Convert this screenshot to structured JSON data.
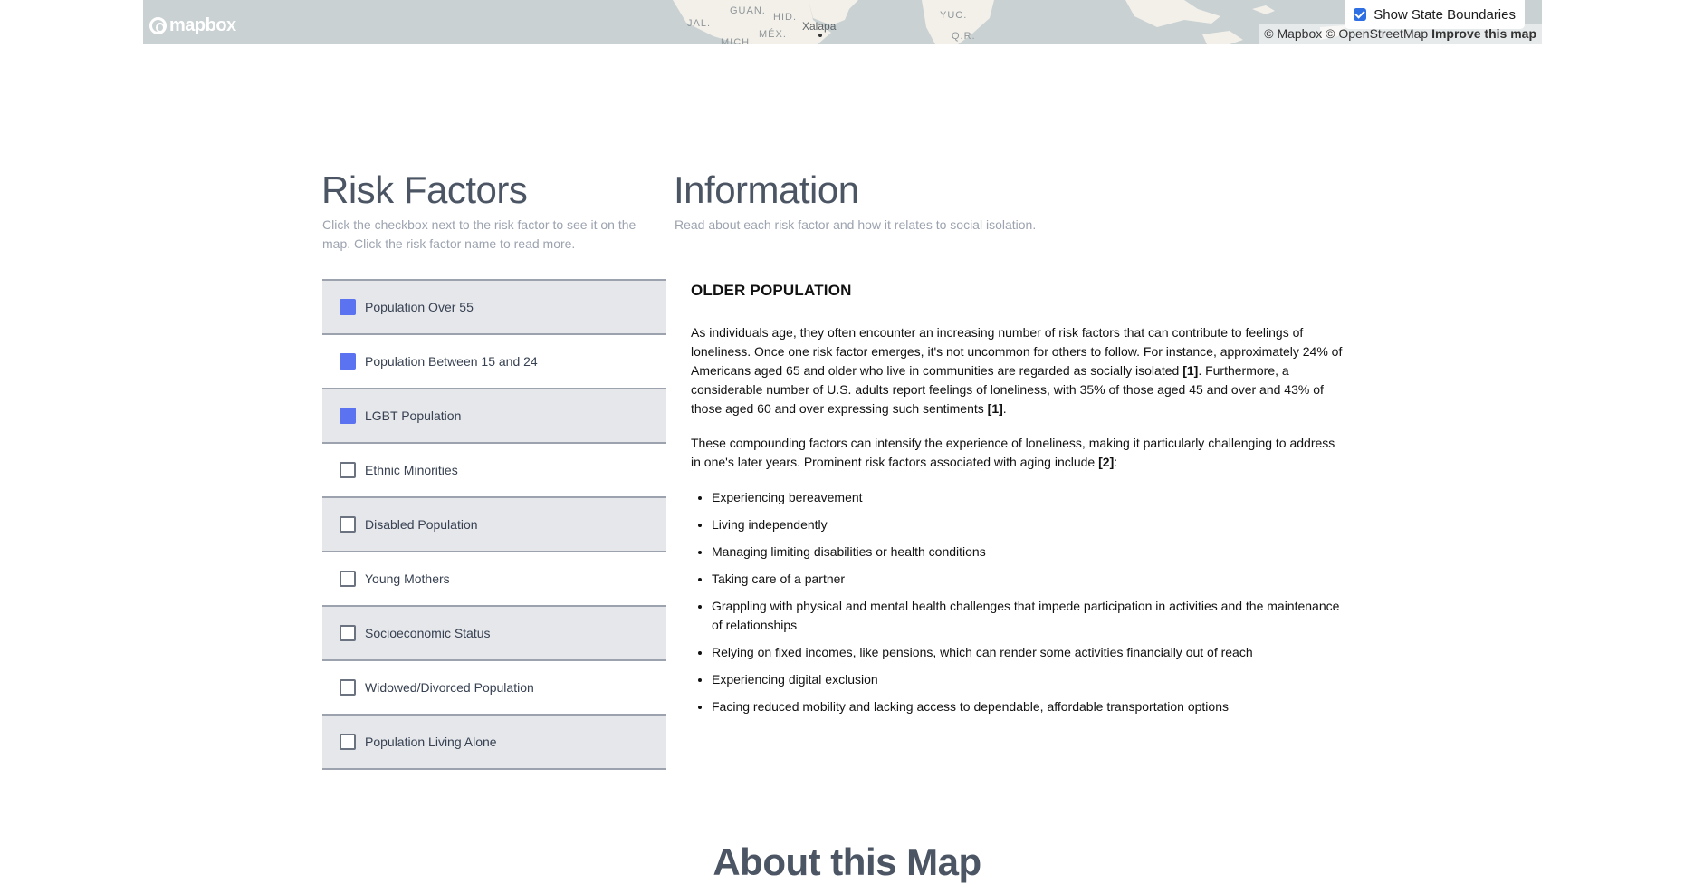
{
  "map": {
    "logo_text": "mapbox",
    "labels": {
      "guan": "GUAN.",
      "hid": "HID.",
      "jal": "JAL.",
      "mex": "MÉX.",
      "mich": "MICH.",
      "xalapa": "Xalapa",
      "yuc": "YUC.",
      "qr": "Q.R."
    },
    "attribution_mapbox": "© Mapbox",
    "attribution_osm": "© OpenStreetMap",
    "attribution_improve": "Improve this map",
    "boundaries_label": "Show State Boundaries",
    "boundaries_checked": true,
    "land_color": "#f3f0ea",
    "water_color": "#c9d1d3"
  },
  "risk": {
    "title": "Risk Factors",
    "subtitle": "Click the checkbox next to the risk factor to see it on the map. Click the risk factor name to read more.",
    "items": [
      {
        "label": "Population Over 55",
        "checked": true
      },
      {
        "label": "Population Between 15 and 24",
        "checked": true
      },
      {
        "label": "LGBT Population",
        "checked": true
      },
      {
        "label": "Ethnic Minorities",
        "checked": false
      },
      {
        "label": "Disabled Population",
        "checked": false
      },
      {
        "label": "Young Mothers",
        "checked": false
      },
      {
        "label": "Socioeconomic Status",
        "checked": false
      },
      {
        "label": "Widowed/Divorced Population",
        "checked": false
      },
      {
        "label": "Population Living Alone",
        "checked": false
      }
    ],
    "check_color": "#5b73f0"
  },
  "info": {
    "title": "Information",
    "subtitle": "Read about each risk factor and how it relates to social isolation.",
    "heading": "OLDER POPULATION",
    "p1_a": "As individuals age, they often encounter an increasing number of risk factors that can contribute to feelings of loneliness. Once one risk factor emerges, it's not uncommon for others to follow. For instance, approximately 24% of Americans aged 65 and older who live in communities are regarded as socially isolated ",
    "p1_ref1": "[1]",
    "p1_b": ". Furthermore, a considerable number of U.S. adults report feelings of loneliness, with 35% of those aged 45 and over and 43% of those aged 60 and over expressing such sentiments ",
    "p1_ref2": "[1]",
    "p1_c": ".",
    "p2_a": "These compounding factors can intensify the experience of loneliness, making it particularly challenging to address in one's later years. Prominent risk factors associated with aging include ",
    "p2_ref": "[2]",
    "p2_b": ":",
    "bullets": [
      "Experiencing bereavement",
      "Living independently",
      "Managing limiting disabilities or health conditions",
      "Taking care of a partner",
      "Grappling with physical and mental health challenges that impede participation in activities and the maintenance of relationships",
      "Relying on fixed incomes, like pensions, which can render some activities financially out of reach",
      "Experiencing digital exclusion",
      "Facing reduced mobility and lacking access to dependable, affordable transportation options"
    ]
  },
  "about": {
    "title": "About this Map"
  }
}
